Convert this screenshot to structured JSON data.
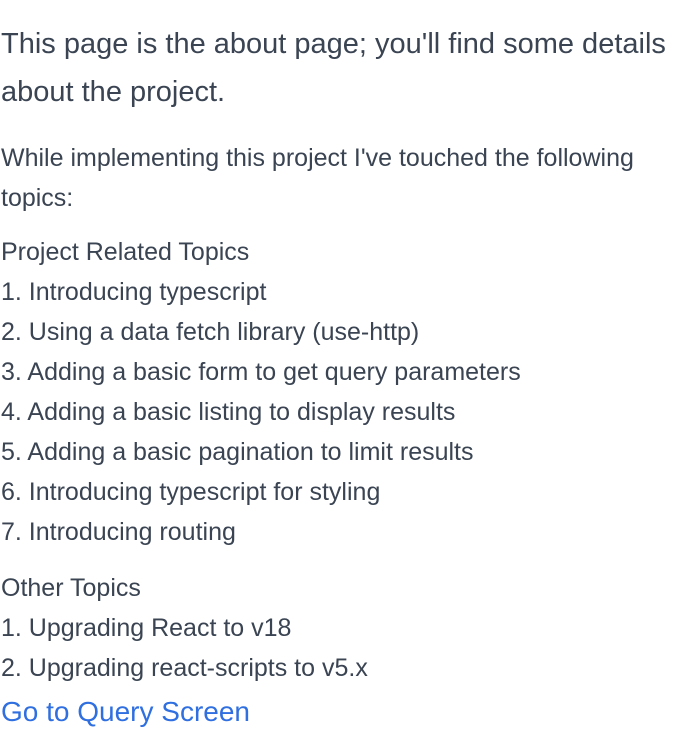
{
  "heading": "This page is the about page; you'll find some details about the project.",
  "intro": "While implementing this project I've touched the following topics:",
  "project_topics": {
    "title": "Project Related Topics",
    "items": [
      "1. Introducing typescript",
      "2. Using a data fetch library (use-http)",
      "3. Adding a basic form to get query parameters",
      "4. Adding a basic listing to display results",
      "5. Adding a basic pagination to limit results",
      "6. Introducing typescript for styling",
      "7. Introducing routing"
    ]
  },
  "other_topics": {
    "title": "Other Topics",
    "items": [
      "1. Upgrading React to v18",
      "2. Upgrading react-scripts to v5.x"
    ]
  },
  "link": {
    "label": "Go to Query Screen"
  },
  "colors": {
    "text": "#3a4452",
    "link": "#2f6fe0",
    "background": "#ffffff"
  }
}
